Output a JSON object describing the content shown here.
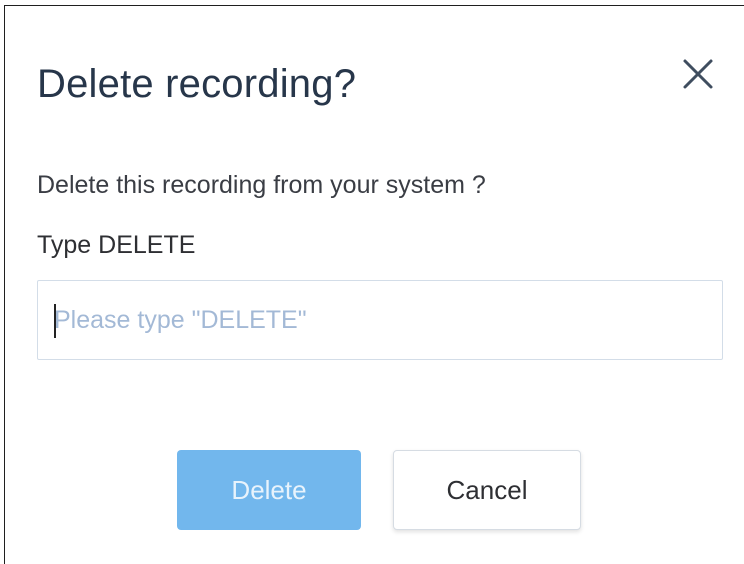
{
  "dialog": {
    "title": "Delete recording?",
    "message": "Delete this recording from your system ?",
    "field_label": "Type DELETE",
    "input": {
      "value": "",
      "placeholder": "Please type \"DELETE\""
    },
    "close_icon": "close-icon",
    "buttons": {
      "delete_label": "Delete",
      "cancel_label": "Cancel"
    }
  },
  "colors": {
    "title": "#27364a",
    "primary_disabled": "#72b7ed",
    "placeholder": "#a3b9d6",
    "input_border": "#d3dde8"
  }
}
